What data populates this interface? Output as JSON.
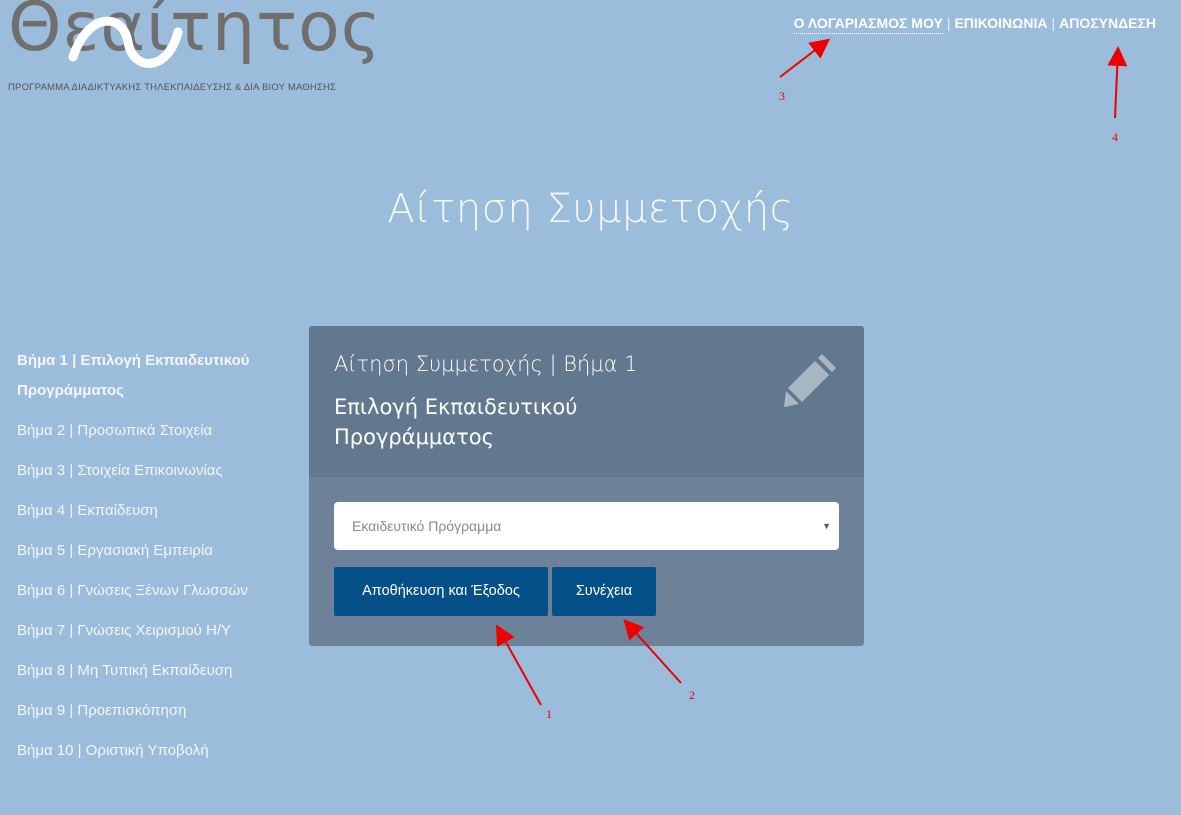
{
  "logo": {
    "wordmark": "Θεαίτητος",
    "subtitle": "ΠΡΟΓΡΑΜΜΑ ΔΙΑΔΙΚΤΥΑΚΗΣ ΤΗΛΕΚΠΑΙΔΕΥΣΗΣ & ΔΙΑ ΒΙΟΥ ΜΑΘΗΣΗΣ"
  },
  "topnav": {
    "items": [
      {
        "label": "Ο ΛΟΓΑΡΙΑΣΜΟΣ ΜΟΥ"
      },
      {
        "label": "ΕΠΙΚΟΙΝΩΝΙΑ"
      },
      {
        "label": "ΑΠΟΣΥΝΔΕΣΗ"
      }
    ],
    "separator": "|"
  },
  "page_title": "Αίτηση Συμμετοχής",
  "steps": [
    {
      "label": "Βήμα 1 | Επιλογή Εκπαιδευτικού Προγράμματος",
      "active": true
    },
    {
      "label": "Βήμα 2 | Προσωπικά Στοιχεία"
    },
    {
      "label": "Βήμα 3 | Στοιχεία Επικοινωνίας"
    },
    {
      "label": "Βήμα 4 | Εκπαίδευση"
    },
    {
      "label": "Βήμα 5 | Εργασιακή Εμπειρία"
    },
    {
      "label": "Βήμα 6 | Γνώσεις Ξένων Γλωσσών"
    },
    {
      "label": "Βήμα 7 | Γνώσεις Χειρισμού Η/Υ"
    },
    {
      "label": "Βήμα 8 | Μη Τυπική Εκπαίδευση"
    },
    {
      "label": "Βήμα 9 | Προεπισκόπηση"
    },
    {
      "label": "Βήμα 10 | Οριστική Υποβολή"
    }
  ],
  "card": {
    "title": "Αίτηση Συμμετοχής | Βήμα 1",
    "subtitle": "Επιλογή Εκπαιδευτικού Προγράμματος",
    "icon": "pencil-icon",
    "select_placeholder": "Εκαιδευτικό Πρόγραμμα",
    "save_button": "Αποθήκευση και Έξοδος",
    "next_button": "Συνέχεια"
  },
  "annotations": [
    "1",
    "2",
    "3",
    "4"
  ],
  "colors": {
    "background": "#9bbcdb",
    "card": "#6d8298",
    "card_header": "#62788e",
    "button": "#06508a",
    "annotation": "#e00000"
  }
}
